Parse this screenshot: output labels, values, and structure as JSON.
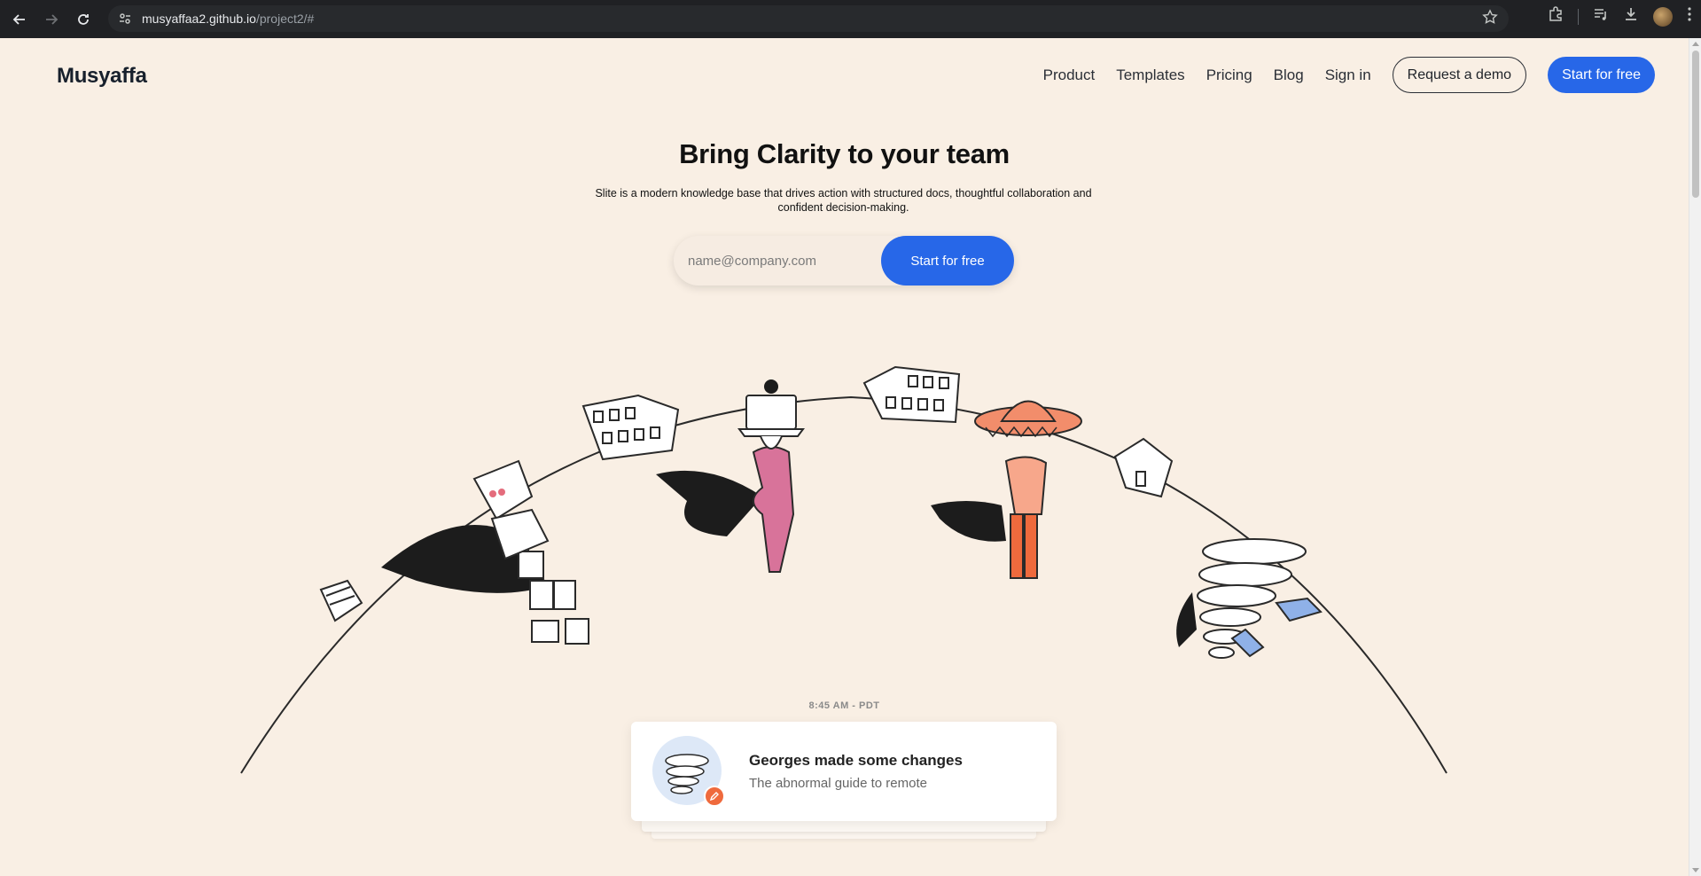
{
  "browser": {
    "url_host": "musyaffaa2.github.io",
    "url_path": "/project2/#",
    "icons": [
      "back-icon",
      "forward-icon",
      "reload-icon",
      "site-settings-icon",
      "star-icon",
      "extensions-icon",
      "media-icon",
      "download-icon",
      "profile-avatar",
      "menu-icon"
    ]
  },
  "site": {
    "logo": "Musyaffa",
    "nav": {
      "links": [
        "Product",
        "Templates",
        "Pricing",
        "Blog",
        "Sign in"
      ],
      "demo_button": "Request a demo",
      "cta_button": "Start for free"
    },
    "hero": {
      "title": "Bring Clarity to your team",
      "subtitle": "Slite is a modern knowledge base that drives action with structured docs, thoughtful collaboration and confident decision-making.",
      "email_placeholder": "name@company.com",
      "cta": "Start for free"
    },
    "notification": {
      "time": "8:45 AM - PDT",
      "title": "Georges made some changes",
      "subtitle": "The abnormal guide to remote"
    },
    "colors": {
      "background": "#f9efe4",
      "primary": "#2767e8",
      "badge": "#ef6a3d"
    }
  }
}
